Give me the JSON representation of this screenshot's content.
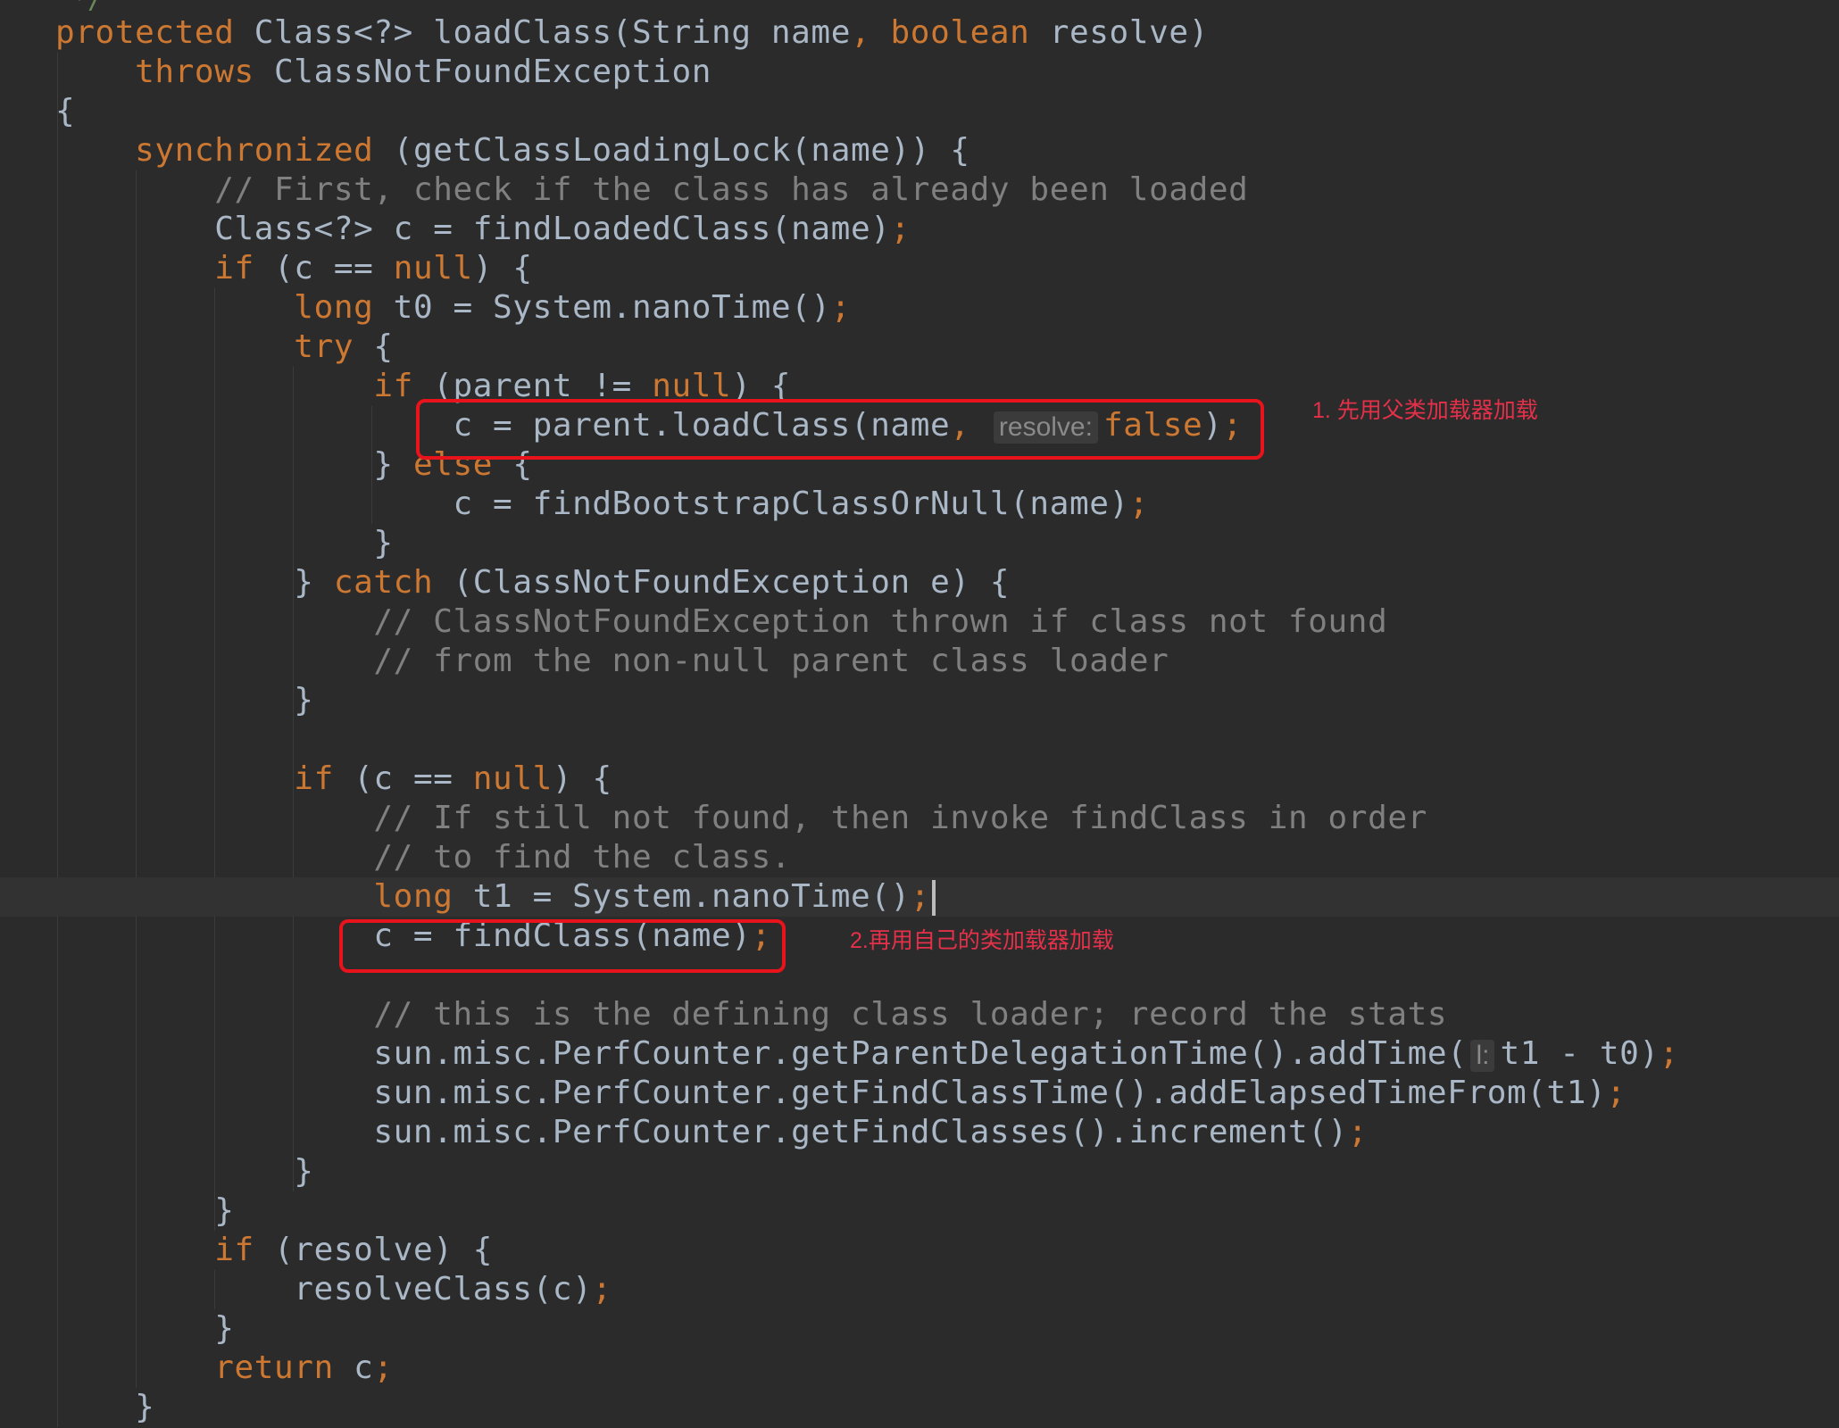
{
  "editor": {
    "top_fragment": "*/",
    "lines": [
      [
        [
          "kw",
          "protected "
        ],
        [
          "pl",
          "Class<?> loadClass(String name"
        ],
        [
          "kw",
          ", boolean "
        ],
        [
          "pl",
          "resolve)"
        ]
      ],
      [
        [
          "pl",
          "    "
        ],
        [
          "kw",
          "throws "
        ],
        [
          "pl",
          "ClassNotFoundException"
        ]
      ],
      [
        [
          "pl",
          "{"
        ]
      ],
      [
        [
          "pl",
          "    "
        ],
        [
          "kw",
          "synchronized "
        ],
        [
          "pl",
          "(getClassLoadingLock(name)) {"
        ]
      ],
      [
        [
          "pl",
          "        "
        ],
        [
          "cm",
          "// First, check if the class has already been loaded"
        ]
      ],
      [
        [
          "pl",
          "        Class<?> c = findLoadedClass(name)"
        ],
        [
          "kw",
          ";"
        ]
      ],
      [
        [
          "pl",
          "        "
        ],
        [
          "kw",
          "if "
        ],
        [
          "pl",
          "(c == "
        ],
        [
          "kw",
          "null"
        ],
        [
          "pl",
          ") {"
        ]
      ],
      [
        [
          "pl",
          "            "
        ],
        [
          "kw",
          "long "
        ],
        [
          "pl",
          "t0 = System.nanoTime()"
        ],
        [
          "kw",
          ";"
        ]
      ],
      [
        [
          "pl",
          "            "
        ],
        [
          "kw",
          "try "
        ],
        [
          "pl",
          "{"
        ]
      ],
      [
        [
          "pl",
          "                "
        ],
        [
          "kw",
          "if "
        ],
        [
          "pl",
          "(parent != "
        ],
        [
          "kw",
          "null"
        ],
        [
          "pl",
          ") {"
        ]
      ],
      [
        [
          "pl",
          "                    c = parent.loadClass(name"
        ],
        [
          "kw",
          ", "
        ],
        [
          "hint",
          "resolve:"
        ],
        [
          "kw",
          "false"
        ],
        [
          "pl",
          ")"
        ],
        [
          "kw",
          ";"
        ]
      ],
      [
        [
          "pl",
          "                } "
        ],
        [
          "kw",
          "else "
        ],
        [
          "pl",
          "{"
        ]
      ],
      [
        [
          "pl",
          "                    c = findBootstrapClassOrNull(name)"
        ],
        [
          "kw",
          ";"
        ]
      ],
      [
        [
          "pl",
          "                }"
        ]
      ],
      [
        [
          "pl",
          "            } "
        ],
        [
          "kw",
          "catch "
        ],
        [
          "pl",
          "(ClassNotFoundException e) {"
        ]
      ],
      [
        [
          "pl",
          "                "
        ],
        [
          "cm",
          "// ClassNotFoundException thrown if class not found"
        ]
      ],
      [
        [
          "pl",
          "                "
        ],
        [
          "cm",
          "// from the non-null parent class loader"
        ]
      ],
      [
        [
          "pl",
          "            }"
        ]
      ],
      [],
      [
        [
          "pl",
          "            "
        ],
        [
          "kw",
          "if "
        ],
        [
          "pl",
          "(c == "
        ],
        [
          "kw",
          "null"
        ],
        [
          "pl",
          ") {"
        ]
      ],
      [
        [
          "pl",
          "                "
        ],
        [
          "cm",
          "// If still not found, then invoke findClass in order"
        ]
      ],
      [
        [
          "pl",
          "                "
        ],
        [
          "cm",
          "// to find the class."
        ]
      ],
      [
        [
          "pl",
          "                "
        ],
        [
          "kw",
          "long "
        ],
        [
          "pl",
          "t1 = System.nanoTime()"
        ],
        [
          "kw",
          ";"
        ],
        [
          "caret",
          ""
        ]
      ],
      [
        [
          "pl",
          "                c = findClass(name)"
        ],
        [
          "kw",
          ";"
        ]
      ],
      [],
      [
        [
          "pl",
          "                "
        ],
        [
          "cm",
          "// this is the defining class loader; record the stats"
        ]
      ],
      [
        [
          "pl",
          "                sun.misc.PerfCounter.getParentDelegationTime().addTime("
        ],
        [
          "hint",
          "l:"
        ],
        [
          "pl",
          "t1 - t0)"
        ],
        [
          "kw",
          ";"
        ]
      ],
      [
        [
          "pl",
          "                sun.misc.PerfCounter.getFindClassTime().addElapsedTimeFrom(t1)"
        ],
        [
          "kw",
          ";"
        ]
      ],
      [
        [
          "pl",
          "                sun.misc.PerfCounter.getFindClasses().increment()"
        ],
        [
          "kw",
          ";"
        ]
      ],
      [
        [
          "pl",
          "            }"
        ]
      ],
      [
        [
          "pl",
          "        }"
        ]
      ],
      [
        [
          "pl",
          "        "
        ],
        [
          "kw",
          "if "
        ],
        [
          "pl",
          "(resolve) {"
        ]
      ],
      [
        [
          "pl",
          "            resolveClass(c)"
        ],
        [
          "kw",
          ";"
        ]
      ],
      [
        [
          "pl",
          "        }"
        ]
      ],
      [
        [
          "pl",
          "        "
        ],
        [
          "kw",
          "return "
        ],
        [
          "pl",
          "c"
        ],
        [
          "kw",
          ";"
        ]
      ],
      [
        [
          "pl",
          "    }"
        ]
      ]
    ],
    "current_line_index": 22
  },
  "annotations": {
    "note1": "1. 先用父类加载器加载",
    "note2": "2.再用自己的类加载器加载"
  },
  "colors": {
    "background": "#2b2b2b",
    "keyword": "#cc7832",
    "comment": "#808080",
    "plain": "#a9b7c6",
    "highlight_box": "#e8131b",
    "note_text": "#e5304a"
  }
}
